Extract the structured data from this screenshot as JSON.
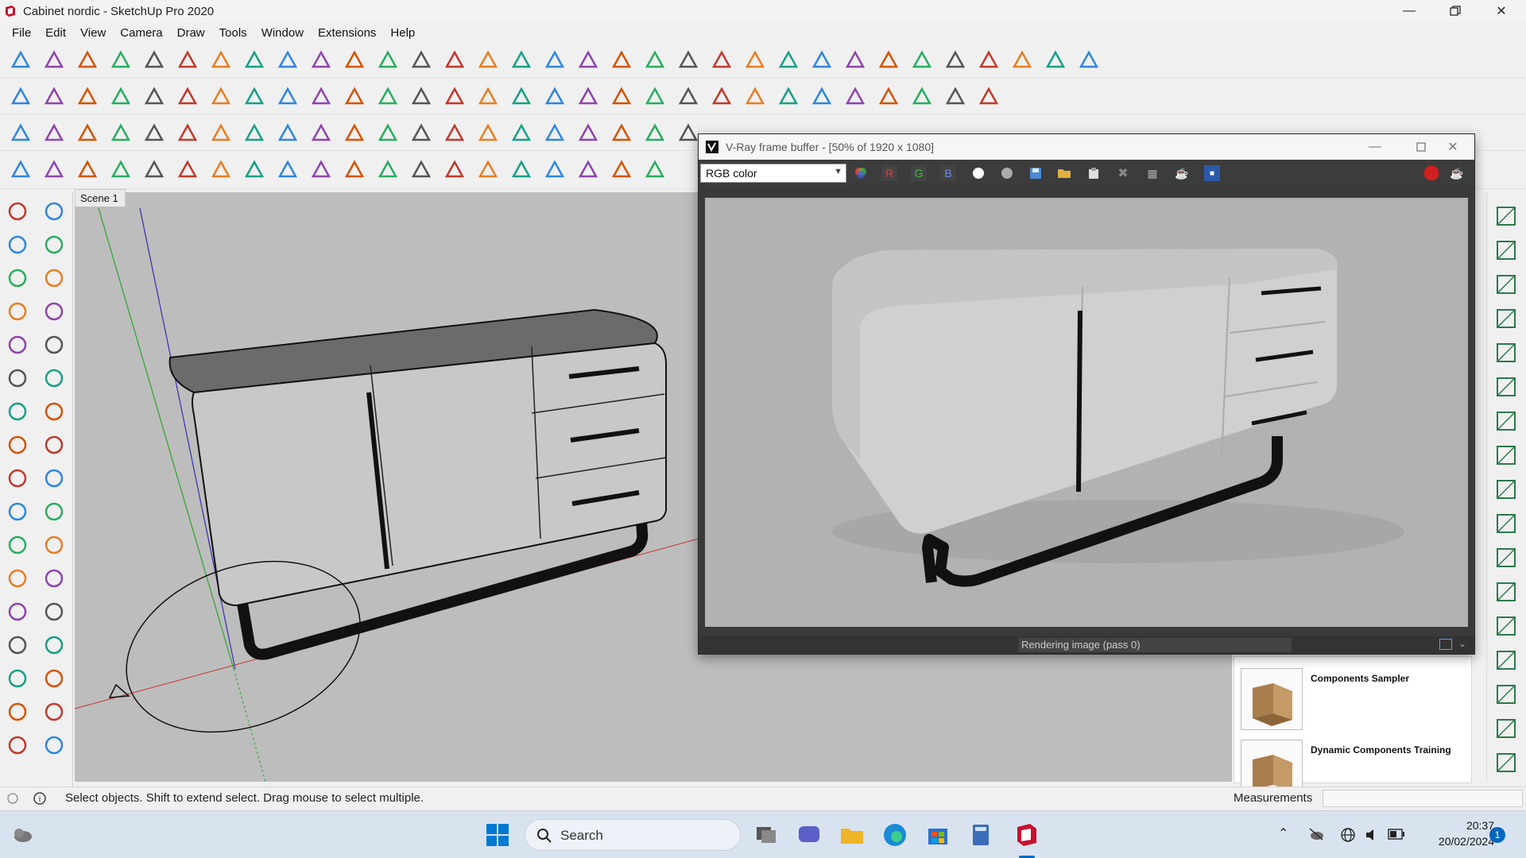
{
  "window": {
    "title": "Cabinet nordic - SketchUp Pro 2020",
    "controls": [
      "minimize",
      "maximize",
      "close"
    ]
  },
  "menu": [
    "File",
    "Edit",
    "View",
    "Camera",
    "Draw",
    "Tools",
    "Window",
    "Extensions",
    "Help"
  ],
  "scene_tab": "Scene 1",
  "vfb": {
    "title": "V-Ray frame buffer - [50% of 1920 x 1080]",
    "channel": "RGB color",
    "channel_buttons": [
      "R",
      "G",
      "B"
    ],
    "status": "Rendering image (pass 0)"
  },
  "components": {
    "items": [
      {
        "label": "Components Sampler"
      },
      {
        "label": "Dynamic Components Training"
      }
    ]
  },
  "statusbar": {
    "hint": "Select objects. Shift to extend select. Drag mouse to select multiple.",
    "measurements_label": "Measurements"
  },
  "taskbar": {
    "search_placeholder": "Search",
    "time": "20:37",
    "date": "20/02/2024",
    "notification_count": "1"
  },
  "colors": {
    "accent": "#0067c0",
    "sketchup_red": "#c8102e",
    "viewport_bg": "#bdbdbd",
    "render_bg": "#b2b2b2"
  },
  "icons": {
    "toolbar_row1": [
      "select-icon",
      "eraser-icon",
      "pencil-icon",
      "freehand-icon",
      "rectangle-icon",
      "push-pull-icon",
      "follow-me-icon",
      "move-icon",
      "rotate-icon",
      "scale-icon",
      "tape-icon",
      "text-icon",
      "paint-icon",
      "orbit-icon",
      "pan-icon",
      "zoom-icon",
      "zoom-extents-icon",
      "warehouse-icon",
      "extension-warehouse-icon",
      "layout-icon",
      "ruby-icon",
      "account-icon",
      "outliner-icon",
      "components-icon",
      "iso-icon",
      "top-icon",
      "front-icon",
      "xray-icon",
      "wireframe-icon",
      "shaded-icon",
      "vray-icon",
      "vray-render-icon",
      "cloud-icon"
    ],
    "right_tray": [
      "select-icon",
      "nest-icon",
      "section-icon",
      "layers-icon",
      "layer-add-icon",
      "layer-remove-icon",
      "group-icon",
      "line-icon",
      "grid-icon"
    ]
  }
}
